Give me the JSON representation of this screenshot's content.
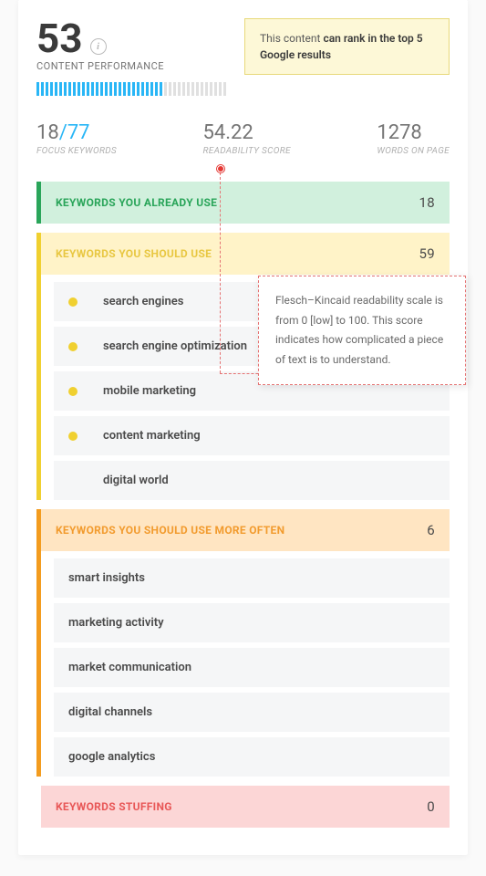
{
  "score": {
    "value": "53",
    "label": "CONTENT PERFORMANCE",
    "progress_filled": 28,
    "progress_total": 42
  },
  "rank_message": {
    "pre": "This content ",
    "bold": "can rank in the top 5 Google results"
  },
  "metrics": {
    "focus_keywords": {
      "current": "18",
      "total": "77",
      "label": "FOCUS KEYWORDS"
    },
    "readability": {
      "value": "54.22",
      "label": "READABILITY SCORE"
    },
    "words": {
      "value": "1278",
      "label": "WORDS ON PAGE"
    }
  },
  "tooltip": "Flesch–Kincaid readability scale is from 0 [low] to 100. This score indicates how complicated a piece of text is to understand.",
  "sections": {
    "already_use": {
      "title": "KEYWORDS YOU ALREADY USE",
      "count": "18"
    },
    "should_use": {
      "title": "KEYWORDS YOU SHOULD USE",
      "count": "59",
      "items": [
        {
          "dot": true,
          "text": "search engines"
        },
        {
          "dot": true,
          "text": "search engine optimization"
        },
        {
          "dot": true,
          "text": "mobile marketing"
        },
        {
          "dot": true,
          "text": "content marketing"
        },
        {
          "dot": false,
          "text": "digital world"
        }
      ]
    },
    "more_often": {
      "title": "KEYWORDS YOU SHOULD USE MORE OFTEN",
      "count": "6",
      "items": [
        {
          "text": "smart insights"
        },
        {
          "text": "marketing activity"
        },
        {
          "text": "market communication"
        },
        {
          "text": "digital channels"
        },
        {
          "text": "google analytics"
        }
      ]
    },
    "stuffing": {
      "title": "KEYWORDS STUFFING",
      "count": "0"
    }
  }
}
